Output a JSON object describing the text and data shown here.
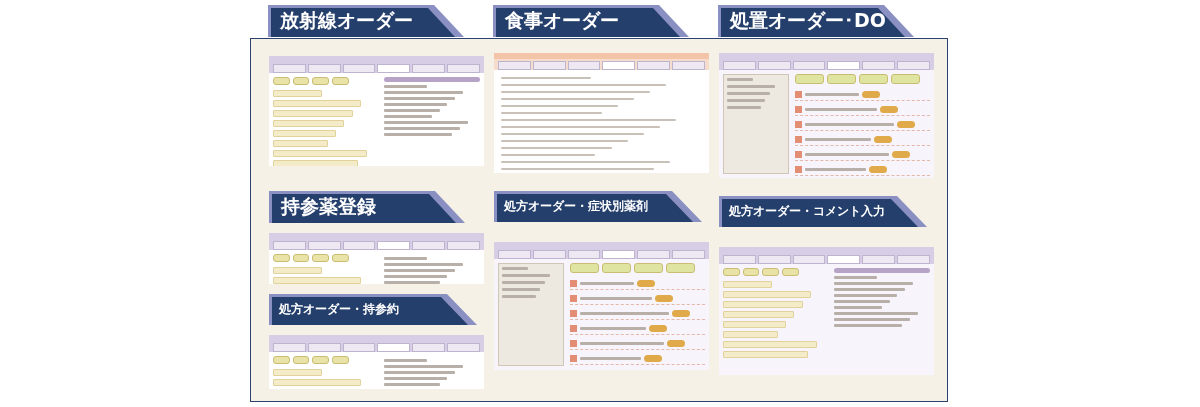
{
  "columns": [
    {
      "sections": [
        {
          "title": "放射線オーダー",
          "kind": "large"
        },
        {
          "title": "持参薬登録",
          "kind": "large"
        },
        {
          "title": "処方オーダー・持参約",
          "kind": "small"
        }
      ]
    },
    {
      "sections": [
        {
          "title": "食事オーダー",
          "kind": "large"
        },
        {
          "title": "処方オーダー・症状別薬剤",
          "kind": "small"
        }
      ]
    },
    {
      "sections": [
        {
          "title": "処置オーダー･DO",
          "kind": "large"
        },
        {
          "title": "処方オーダー・コメント入力",
          "kind": "small"
        }
      ]
    }
  ]
}
